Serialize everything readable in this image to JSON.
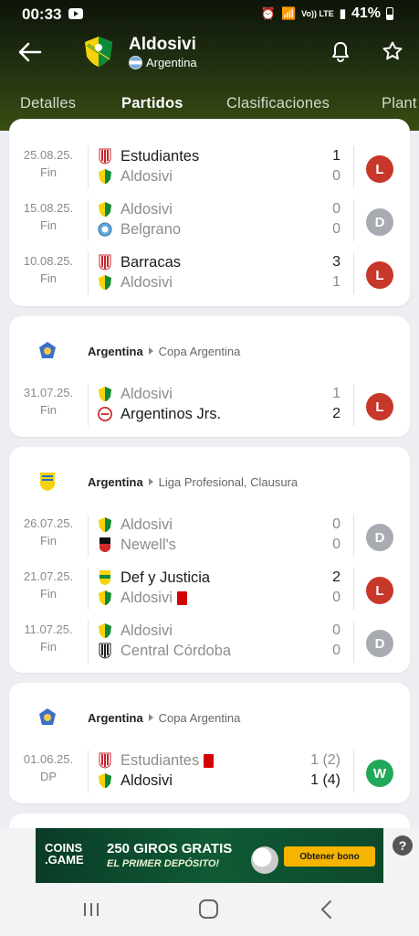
{
  "status_bar": {
    "time": "00:33",
    "signal_label": "Vo)) LTE",
    "battery": "41%"
  },
  "header": {
    "team_name": "Aldosivi",
    "country": "Argentina"
  },
  "tabs": [
    {
      "label": "Detalles"
    },
    {
      "label": "Partidos"
    },
    {
      "label": "Clasificaciones"
    },
    {
      "label": "Plant"
    }
  ],
  "cards": [
    {
      "matches": [
        {
          "date": "25.08.25.",
          "status": "Fin",
          "home": "Estudiantes",
          "away": "Aldosivi",
          "home_score": "1",
          "away_score": "0",
          "result": "L"
        },
        {
          "date": "15.08.25.",
          "status": "Fin",
          "home": "Aldosivi",
          "away": "Belgrano",
          "home_score": "0",
          "away_score": "0",
          "result": "D"
        },
        {
          "date": "10.08.25.",
          "status": "Fin",
          "home": "Barracas",
          "away": "Aldosivi",
          "home_score": "3",
          "away_score": "1",
          "result": "L"
        }
      ]
    },
    {
      "competition": {
        "country": "Argentina",
        "name": "Copa Argentina"
      },
      "matches": [
        {
          "date": "31.07.25.",
          "status": "Fin",
          "home": "Aldosivi",
          "away": "Argentinos Jrs.",
          "home_score": "1",
          "away_score": "2",
          "result": "L"
        }
      ]
    },
    {
      "competition": {
        "country": "Argentina",
        "name": "Liga Profesional, Clausura"
      },
      "matches": [
        {
          "date": "26.07.25.",
          "status": "Fin",
          "home": "Aldosivi",
          "away": "Newell's",
          "home_score": "0",
          "away_score": "0",
          "result": "D"
        },
        {
          "date": "21.07.25.",
          "status": "Fin",
          "home": "Def y Justicia",
          "away": "Aldosivi",
          "home_score": "2",
          "away_score": "0",
          "result": "L"
        },
        {
          "date": "11.07.25.",
          "status": "Fin",
          "home": "Aldosivi",
          "away": "Central Córdoba",
          "home_score": "0",
          "away_score": "0",
          "result": "D"
        }
      ]
    },
    {
      "competition": {
        "country": "Argentina",
        "name": "Copa Argentina"
      },
      "matches": [
        {
          "date": "01.06.25.",
          "status": "DP",
          "home": "Estudiantes",
          "away": "Aldosivi",
          "home_score": "1 (2)",
          "away_score": "1 (4)",
          "result": "W"
        }
      ]
    }
  ],
  "ad": {
    "brand_line1": "COINS",
    "brand_line2": ".GAME",
    "title": "250 GIROS GRATIS",
    "subtitle": "EL PRIMER DEPÓSITO!",
    "button": "Obtener bono",
    "help": "?"
  },
  "colors": {
    "loss": "#c7372a",
    "draw": "#a9abb3",
    "win": "#22a85a",
    "header_dark": "#1a240e"
  }
}
